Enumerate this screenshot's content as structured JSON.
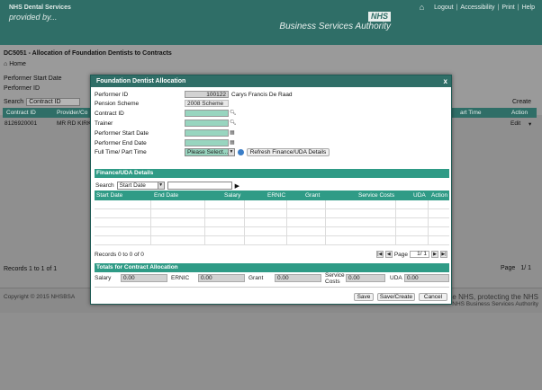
{
  "header": {
    "brand_line1": "NHS Dental Services",
    "brand_line2": "provided by...",
    "nhs_logo": "NHS",
    "bsa_name": "Business Services Authority",
    "nav": [
      "Logout",
      "Accessibility",
      "Print",
      "Help"
    ],
    "home_icon": "home-icon"
  },
  "page": {
    "title": "DC5051 - Allocation of Foundation Dentists to Contracts",
    "breadcrumb": "Home",
    "performer_start_date_label": "Performer Start Date",
    "performer_id_label": "Performer ID",
    "search_label": "Search",
    "search_select": "Contract ID",
    "create_label": "Create",
    "table_headers": [
      "Contract ID",
      "Provider/Co",
      "art Time",
      "Action"
    ],
    "row": {
      "contract_id": "8126920001",
      "provider": "MR RD KIRK",
      "action": "Edit"
    },
    "records_text": "Records 1 to 1 of 1",
    "pager_label": "Page",
    "pager_value": "1/ 1"
  },
  "footer": {
    "copyright": "Copyright © 2015 NHSBSA",
    "tagline": "the NHS, protecting the NHS",
    "tagline2": "NHS Business Services Authority"
  },
  "modal": {
    "title": "Foundation Dentist Allocation",
    "close": "x",
    "fields": {
      "performer_id_label": "Performer ID",
      "performer_id_value": "100122",
      "performer_name": "Carys Francis De Raad",
      "pension_scheme_label": "Pension Scheme",
      "pension_scheme_value": "2008 Scheme",
      "contract_id_label": "Contract ID",
      "trainer_label": "Trainer",
      "start_date_label": "Performer Start Date",
      "end_date_label": "Performer End Date",
      "time_label": "Full Time/ Part Time",
      "time_select": "Please Select...",
      "refresh_button": "Refresh Finance/UDA Details"
    },
    "finance": {
      "section_title": "Finance/UDA Details",
      "search_label": "Search",
      "search_select": "Start Date",
      "columns": [
        "Start Date",
        "End Date",
        "Salary",
        "ERNIC",
        "Grant",
        "Service Costs",
        "UDA",
        "Action"
      ],
      "records_text": "Records 0 to 0 of 0",
      "pager_label": "Page",
      "pager_value": "1/ 1"
    },
    "totals": {
      "section_title": "Totals for Contract Allocation",
      "salary_label": "Salary",
      "salary_value": "0.00",
      "ernic_label": "ERNIC",
      "ernic_value": "0.00",
      "grant_label": "Grant",
      "grant_value": "0.00",
      "service_label": "Service Costs",
      "service_value": "0.00",
      "uda_label": "UDA",
      "uda_value": "0.00"
    },
    "buttons": {
      "save": "Save",
      "save_create": "Save/Create",
      "cancel": "Cancel"
    }
  },
  "colors": {
    "header_teal": "#2f6e67",
    "section_teal": "#2f9b86",
    "input_green": "#98d5bf"
  }
}
